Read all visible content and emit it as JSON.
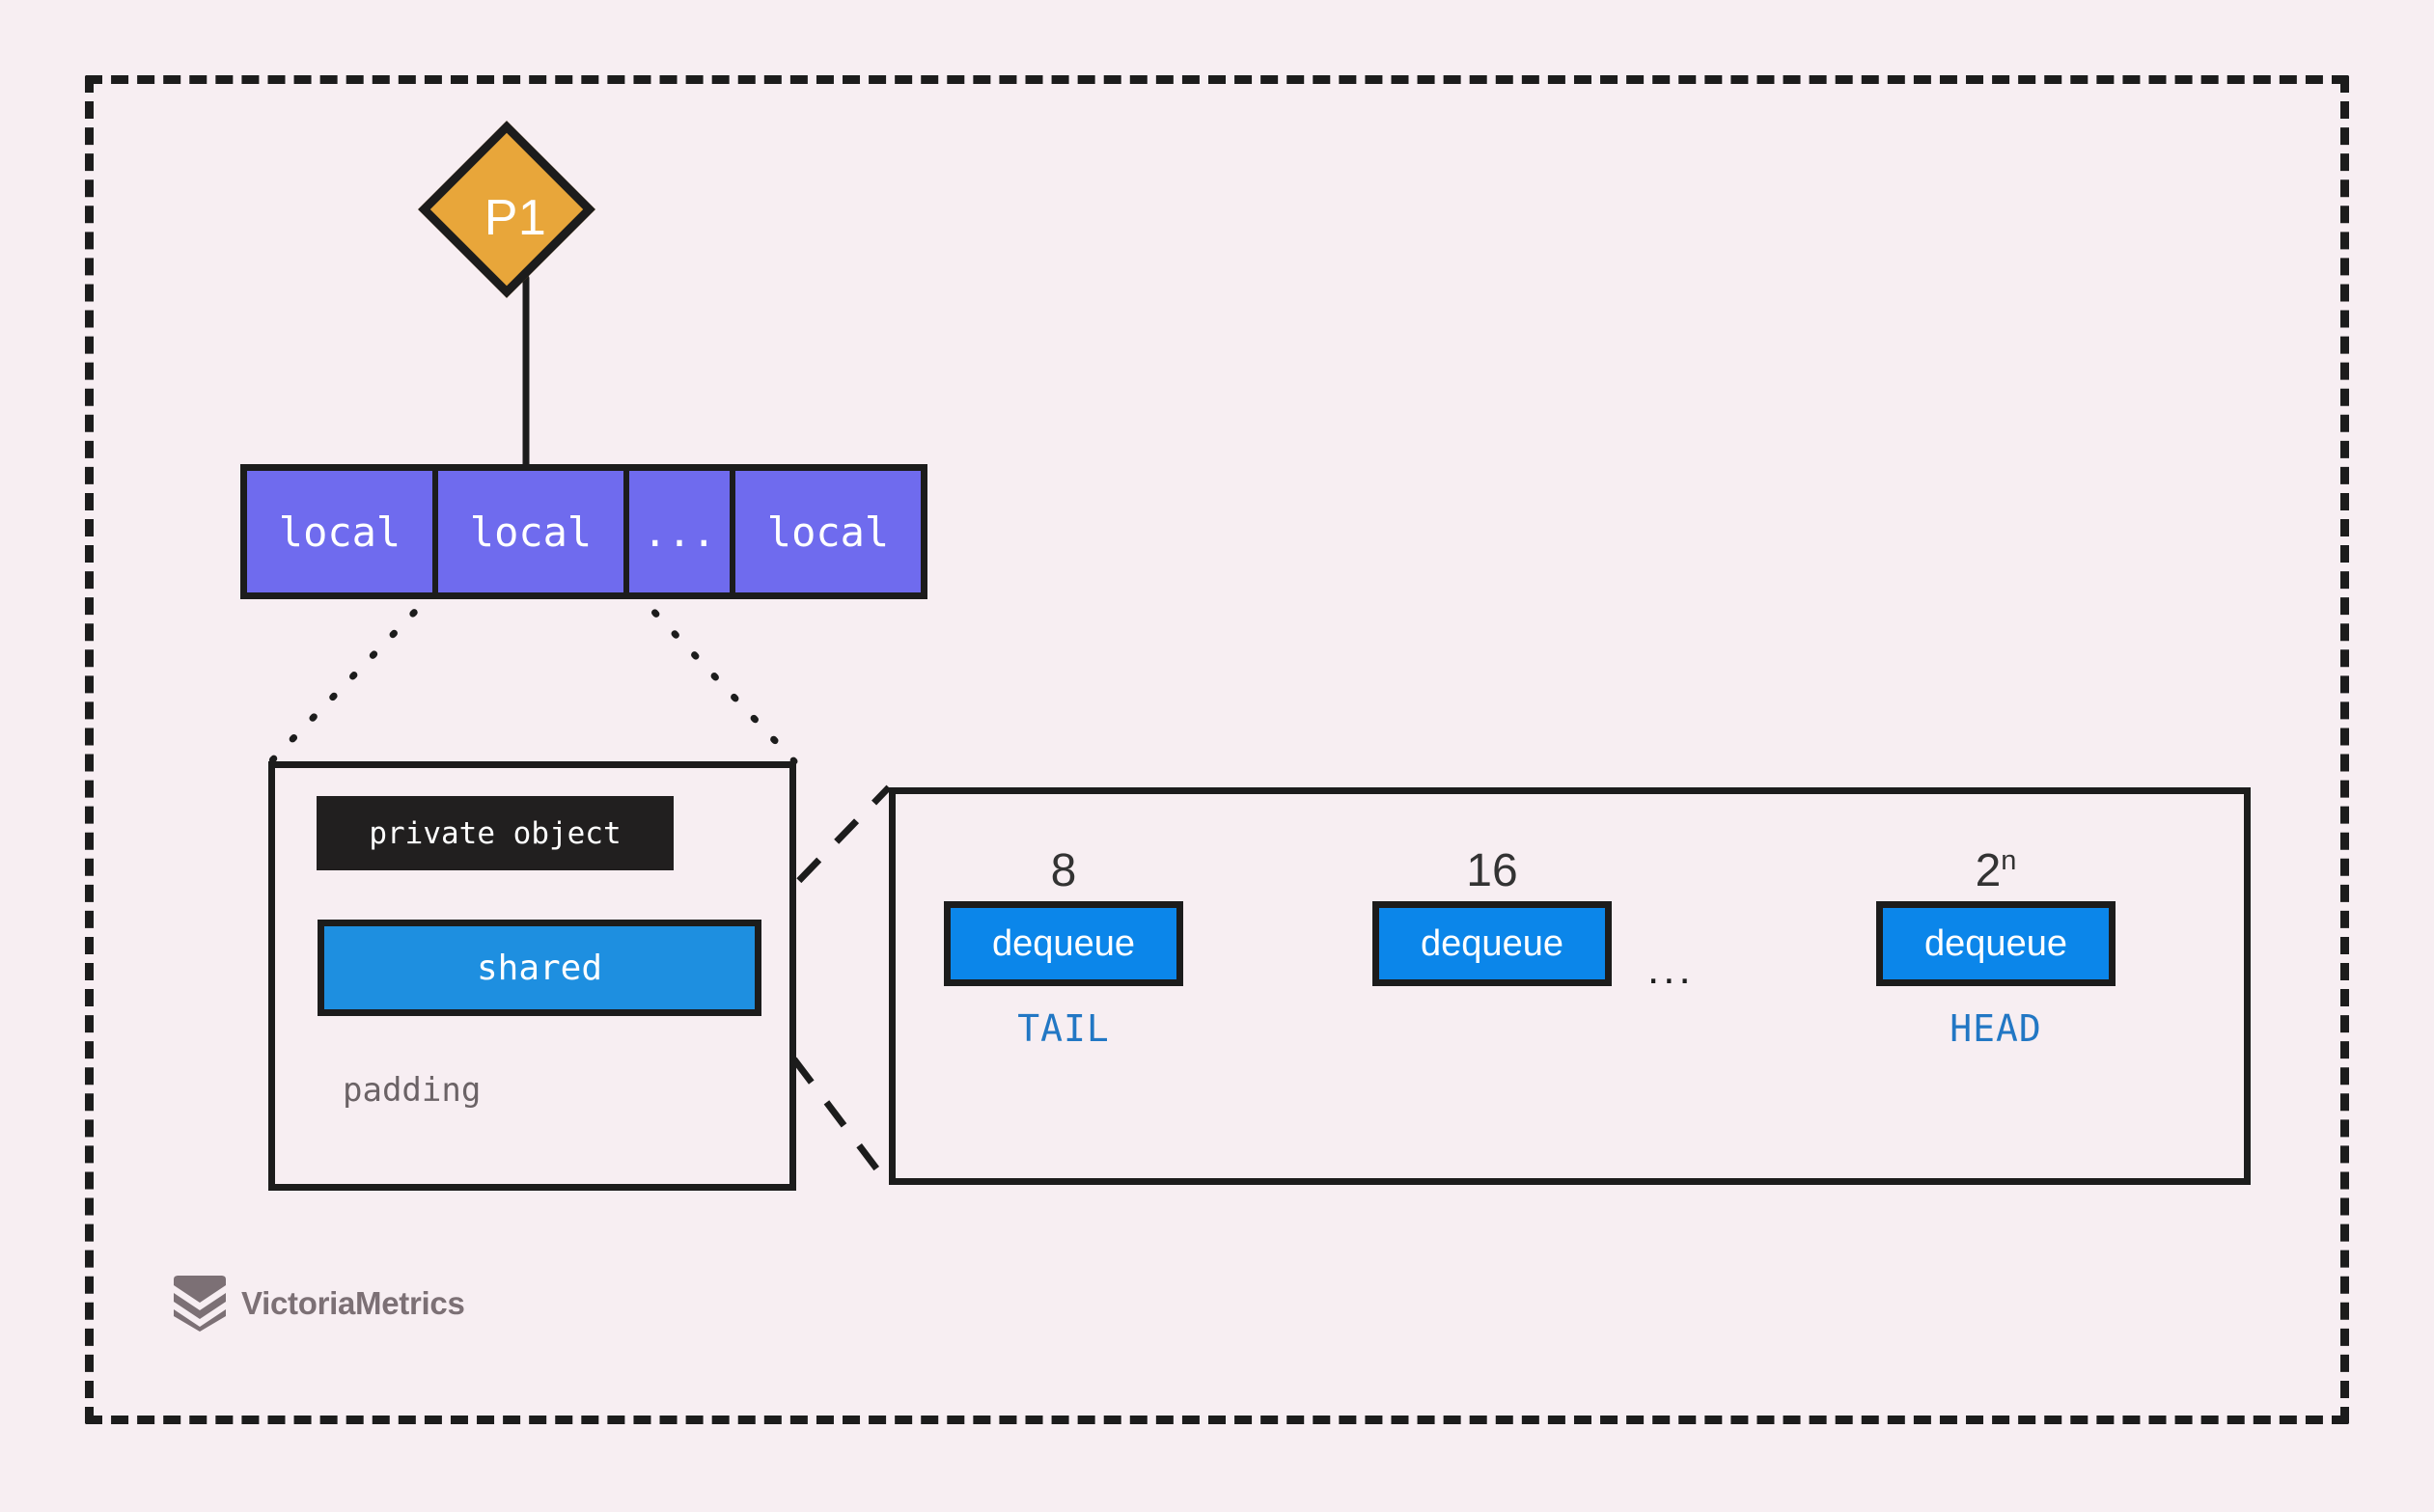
{
  "diagram": {
    "title": "Per-process local slots backed by a shared padded object and a dequeue ring",
    "colors": {
      "background": "#f7eef2",
      "frame": "#1c1c1c",
      "process": "#e8a63a",
      "local": "#6f6bee",
      "private_object": "#211f1f",
      "shared": "#1e8fe0",
      "dequeue": "#0b86ea",
      "tag_text": "#2277c4",
      "padding_text": "#6b6366",
      "logo": "#7c7075"
    }
  },
  "process": {
    "label": "P1"
  },
  "local_slots": [
    {
      "label": "local",
      "kind": "wide"
    },
    {
      "label": "local",
      "kind": "wide"
    },
    {
      "label": "...",
      "kind": "narrow"
    },
    {
      "label": "local",
      "kind": "wide"
    }
  ],
  "private_panel": {
    "private_object_label": "private object",
    "shared_label": "shared",
    "padding_label": "padding"
  },
  "dequeue_panel": {
    "nodes": [
      {
        "capacity": "8",
        "capacity_exp": "",
        "label": "dequeue",
        "tag": "TAIL"
      },
      {
        "capacity": "16",
        "capacity_exp": "",
        "label": "dequeue",
        "tag": ""
      },
      {
        "capacity": "2",
        "capacity_exp": "n",
        "label": "dequeue",
        "tag": "HEAD"
      }
    ],
    "ellipsis": "..."
  },
  "footer": {
    "brand": "VictoriaMetrics",
    "logo_icon": "victoriametrics-chevron-shield-icon"
  }
}
